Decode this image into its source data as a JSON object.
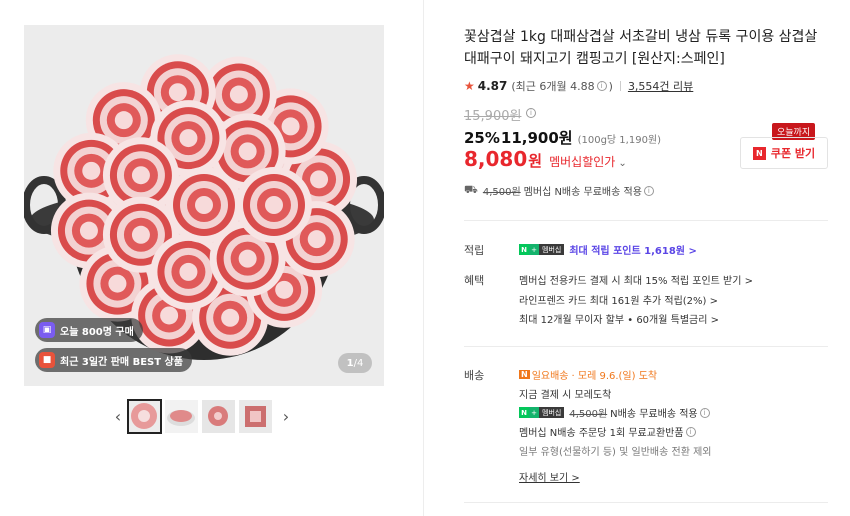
{
  "gallery": {
    "badge_today": "오늘 800명 구매",
    "badge_best": "최근 3일간 판매 BEST 상품",
    "counter_current": "1",
    "counter_total": "/4",
    "prev_icon": "chevron-left-icon",
    "next_icon": "chevron-right-icon"
  },
  "product": {
    "title": "꽃삼겹살 1kg 대패삼겹살 서초갈비 냉삼 듀록 구이용 삼겹살 대패구이 돼지고기 캠핑고기 [원산지:스페인]",
    "rating": "4.87",
    "rating_note": "(최근 6개월 4.88",
    "rating_note_end": ")",
    "reviews": "3,554건 리뷰",
    "original_price": "15,900원",
    "discount_pct": "25%",
    "discount_price": "11,900원",
    "unit_price": "(100g당 1,190원)",
    "member_price": "8,080",
    "member_won": "원",
    "member_label": "멤버십할인가",
    "coupon_tag": "오늘까지",
    "coupon_label": "쿠폰 받기",
    "ship_strike": "4,500원",
    "ship_text": "멤버십 N배송 무료배송 적용"
  },
  "points": {
    "label": "적립",
    "badge_text": "멤버십",
    "text": "최대 적립 포인트 1,618원 >"
  },
  "benefits": {
    "label": "혜택",
    "items": [
      "멤버십 전용카드 결제 시 최대 15% 적립 포인트 받기 >",
      "라인프렌즈 카드 최대 161원 추가 적립(2%) >",
      "최대 12개월 무이자 할부 • 60개월 특별금리 >"
    ]
  },
  "delivery": {
    "label": "배송",
    "type": "일요배송",
    "date": "· 모레 9.6.(일) 도착",
    "line1": "지금 결제 시 모레도착",
    "badge_text": "멤버십",
    "ship_strike": "4,500원",
    "ship_text": "N배송 무료배송 적용",
    "line3": "멤버십 N배송 주문당 1회 무료교환반품",
    "line4": "일부 유형(선물하기 등) 및 일반배송 전환 제외",
    "more": "자세히 보기 >"
  },
  "colors": {
    "accent_red": "#e8272d",
    "naver_green": "#03c75a",
    "member_purple": "#5a45e6",
    "orange": "#f0771b"
  }
}
